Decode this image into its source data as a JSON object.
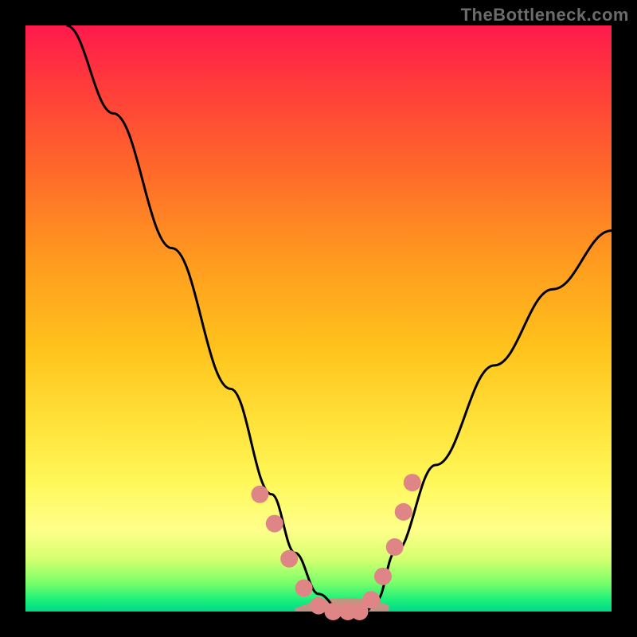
{
  "watermark": "TheBottleneck.com",
  "chart_data": {
    "type": "line",
    "title": "",
    "xlabel": "",
    "ylabel": "",
    "xlim": [
      0,
      100
    ],
    "ylim": [
      0,
      100
    ],
    "grid": false,
    "legend": false,
    "series": [
      {
        "name": "bottleneck-curve",
        "x": [
          7,
          15,
          25,
          35,
          42,
          46,
          50,
          54,
          58,
          60,
          63,
          70,
          80,
          90,
          100
        ],
        "y": [
          100,
          85,
          62,
          38,
          20,
          10,
          3,
          0,
          0,
          2,
          10,
          25,
          42,
          55,
          65
        ],
        "color": "#000000"
      }
    ],
    "markers": {
      "name": "marker-dots",
      "color": "#e08585",
      "x": [
        40,
        42.5,
        45,
        47.5,
        50,
        52.5,
        55,
        57,
        59,
        61,
        63,
        64.5,
        66
      ],
      "y": [
        20,
        15,
        9,
        4,
        1,
        0,
        0,
        0,
        2,
        6,
        11,
        17,
        22
      ]
    },
    "accent_fill": {
      "name": "valley-fill",
      "color": "#e08585",
      "x_range": [
        46,
        62
      ],
      "y_top_approx": 3
    },
    "background_gradient": {
      "stops": [
        {
          "pos": 0,
          "color": "#ff1a4d"
        },
        {
          "pos": 25,
          "color": "#ff6a2a"
        },
        {
          "pos": 55,
          "color": "#ffc31c"
        },
        {
          "pos": 78,
          "color": "#fff85a"
        },
        {
          "pos": 95,
          "color": "#7dff6a"
        },
        {
          "pos": 100,
          "color": "#00d88a"
        }
      ]
    }
  }
}
